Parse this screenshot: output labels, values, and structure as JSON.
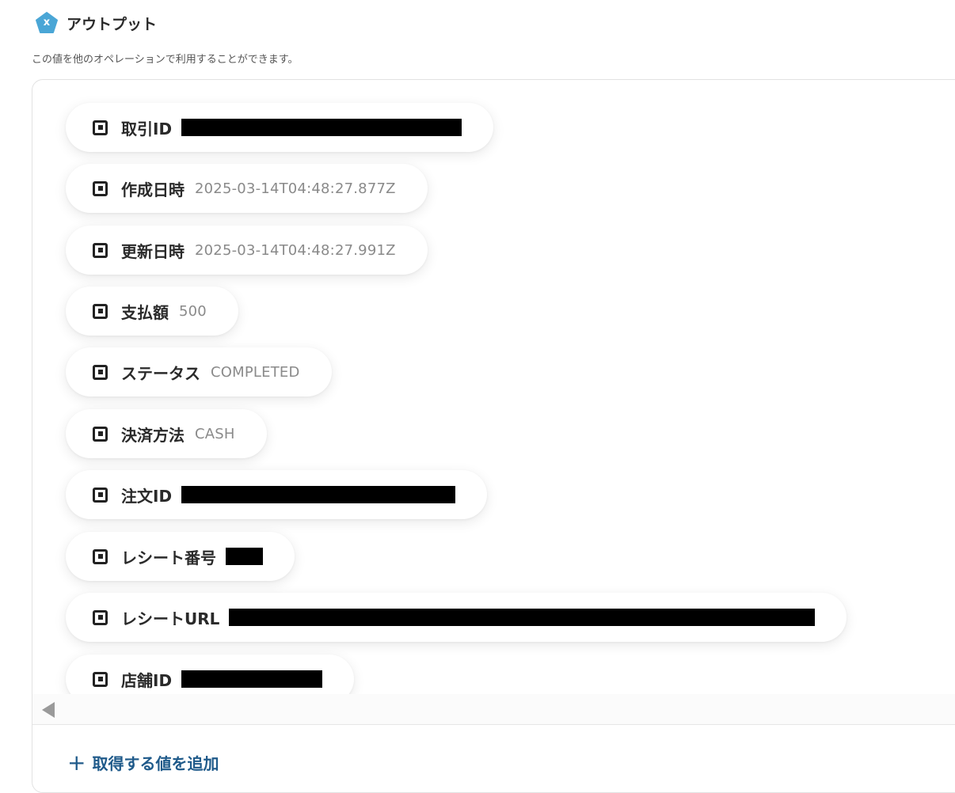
{
  "header": {
    "badge_letter": "x",
    "title": "アウトプット"
  },
  "description": "この値を他のオペレーションで利用することができます。",
  "fields": [
    {
      "label": "取引ID",
      "value": null,
      "redacted": true
    },
    {
      "label": "作成日時",
      "value": "2025-03-14T04:48:27.877Z",
      "redacted": false
    },
    {
      "label": "更新日時",
      "value": "2025-03-14T04:48:27.991Z",
      "redacted": false
    },
    {
      "label": "支払額",
      "value": "500",
      "redacted": false
    },
    {
      "label": "ステータス",
      "value": "COMPLETED",
      "redacted": false
    },
    {
      "label": "決済方法",
      "value": "CASH",
      "redacted": false
    },
    {
      "label": "注文ID",
      "value": null,
      "redacted": true
    },
    {
      "label": "レシート番号",
      "value": null,
      "redacted": true
    },
    {
      "label": "レシートURL",
      "value": null,
      "redacted": true
    },
    {
      "label": "店舗ID",
      "value": null,
      "redacted": true
    }
  ],
  "add_button": {
    "icon": "plus-icon",
    "label": "取得する値を追加"
  },
  "colors": {
    "badge": "#4aa6d6",
    "link": "#1f5a8a",
    "redaction": "#000000"
  }
}
